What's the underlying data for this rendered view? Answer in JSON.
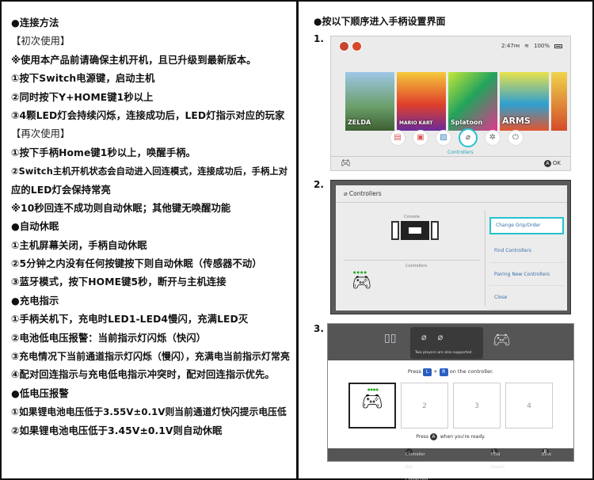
{
  "left": {
    "lines": [
      {
        "text": "●连接方法",
        "style": "normal"
      },
      {
        "text": "【初次使用】",
        "style": "tag"
      },
      {
        "text": "※使用本产品前请确保主机开机，且已升级到最新版本。",
        "style": "normal"
      },
      {
        "text": "①按下Switch电源键，启动主机",
        "style": "normal"
      },
      {
        "text": "②同时按下Y+HOME键1秒以上",
        "style": "normal"
      },
      {
        "text": "③4颗LED灯会持续闪烁，连接成功后，LED灯指示对应的玩家",
        "style": "normal"
      },
      {
        "text": "【再次使用】",
        "style": "tag"
      },
      {
        "text": "①按下手柄Home键1秒以上，唤醒手柄。",
        "style": "normal"
      },
      {
        "text": "②Switch主机开机状态会自动进入回连模式，连接成功后，手柄上对",
        "style": "normal"
      },
      {
        "text": "应的LED灯会保持常亮",
        "style": "normal"
      },
      {
        "text": "※10秒回连不成功则自动休眠；其他键无唤醒功能",
        "style": "normal"
      },
      {
        "text": "●自动休眠",
        "style": "normal"
      },
      {
        "text": "①主机屏幕关闭，手柄自动休眠",
        "style": "normal"
      },
      {
        "text": "②5分钟之内没有任何按键按下则自动休眠（传感器不动）",
        "style": "normal"
      },
      {
        "text": "③蓝牙模式，按下HOME键5秒，断开与主机连接",
        "style": "normal"
      },
      {
        "text": "●充电指示",
        "style": "normal"
      },
      {
        "text": "①手柄关机下，充电时LED1-LED4慢闪，充满LED灭",
        "style": "normal"
      },
      {
        "text": "②电池低电压报警：当前指示灯闪烁（快闪）",
        "style": "normal"
      },
      {
        "text": "③充电情况下当前通道指示灯闪烁（慢闪），充满电当前指示灯常亮",
        "style": "normal"
      },
      {
        "text": "④配对回连指示与充电低电指示冲突时，配对回连指示优先。",
        "style": "normal"
      },
      {
        "text": "●低电压报警",
        "style": "normal"
      },
      {
        "text": "①如果锂电池电压低于3.55V±0.1V则当前通道灯快闪提示电压低",
        "style": "normal"
      },
      {
        "text": "②如果锂电池电压低于3.45V±0.1V则自动休眠",
        "style": "normal"
      }
    ]
  },
  "right": {
    "title": "●按以下顺序进入手柄设置界面",
    "step1": "1.",
    "step2": "2.",
    "step3": "3.",
    "screen1": {
      "time": "2:47",
      "time_suffix": "PM",
      "battery": "100%",
      "games": [
        "ZELDA",
        "MARIO KART",
        "Splatoon",
        "ARMS"
      ],
      "controllers_label": "Controllers",
      "ok_label": "OK"
    },
    "screen2": {
      "header": "Controllers",
      "console_label": "Console",
      "controllers_label": "Controllers",
      "menu": [
        "Change Grip/Order",
        "Find Controllers",
        "Pairing New Controllers",
        "Close"
      ]
    },
    "screen3": {
      "bubble_text": "Two players are also supported.",
      "press_prefix": "Press",
      "key_l": "L",
      "key_plus": "+",
      "key_r": "R",
      "press_suffix": "on the controller.",
      "slots": [
        "2",
        "3",
        "4"
      ],
      "pressa_prefix": "Press",
      "pressa_key": "A",
      "pressa_suffix": "when you're ready.",
      "footer_left": "Controller Not Connecting",
      "footer_mid": "Hold Search",
      "footer_right": "Back"
    }
  },
  "colors": {
    "accent": "#26c2d0",
    "link": "#3a6fa8",
    "key": "#2a5fc1"
  }
}
